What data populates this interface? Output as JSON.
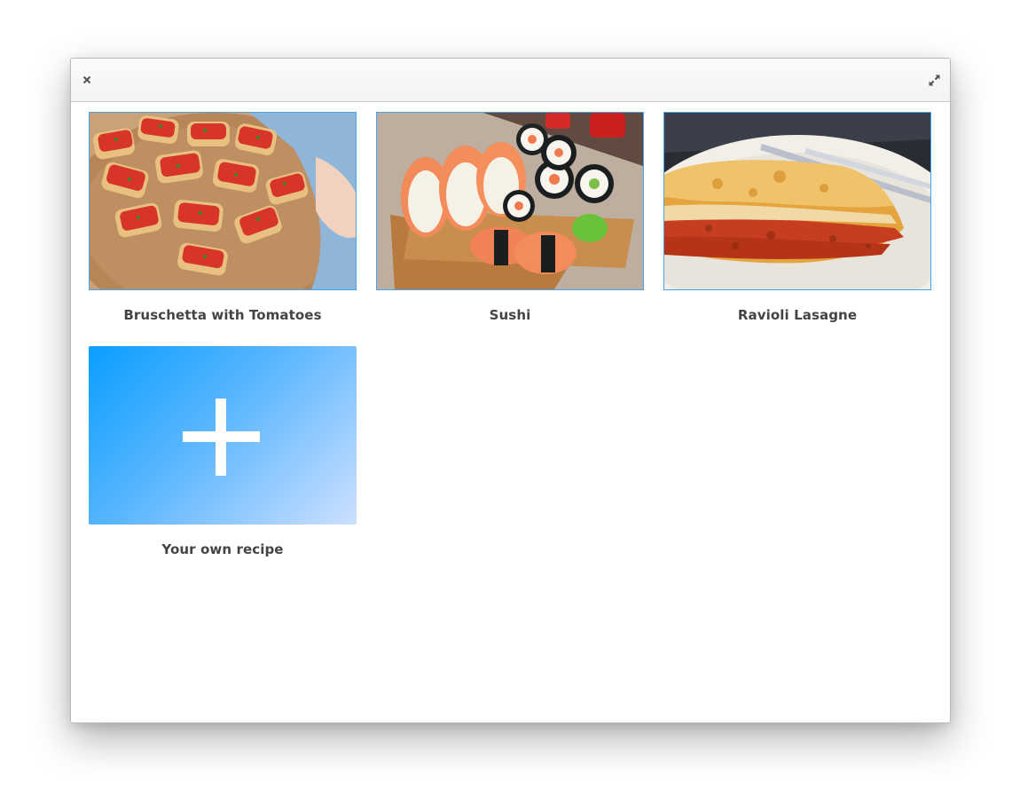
{
  "window": {
    "close_icon": "close-icon",
    "expand_icon": "expand-icon"
  },
  "recipes": [
    {
      "label": "Bruschetta with Tomatoes",
      "image": "bruschetta-photo"
    },
    {
      "label": "Sushi",
      "image": "sushi-photo"
    },
    {
      "label": "Ravioli Lasagne",
      "image": "lasagne-photo"
    }
  ],
  "add_card": {
    "label": "Your own recipe",
    "icon": "plus-icon",
    "gradient_start": "#0a9eff",
    "gradient_end": "#cde0ff"
  },
  "colors": {
    "card_border": "#4aa3e8",
    "label_text": "#444444"
  }
}
